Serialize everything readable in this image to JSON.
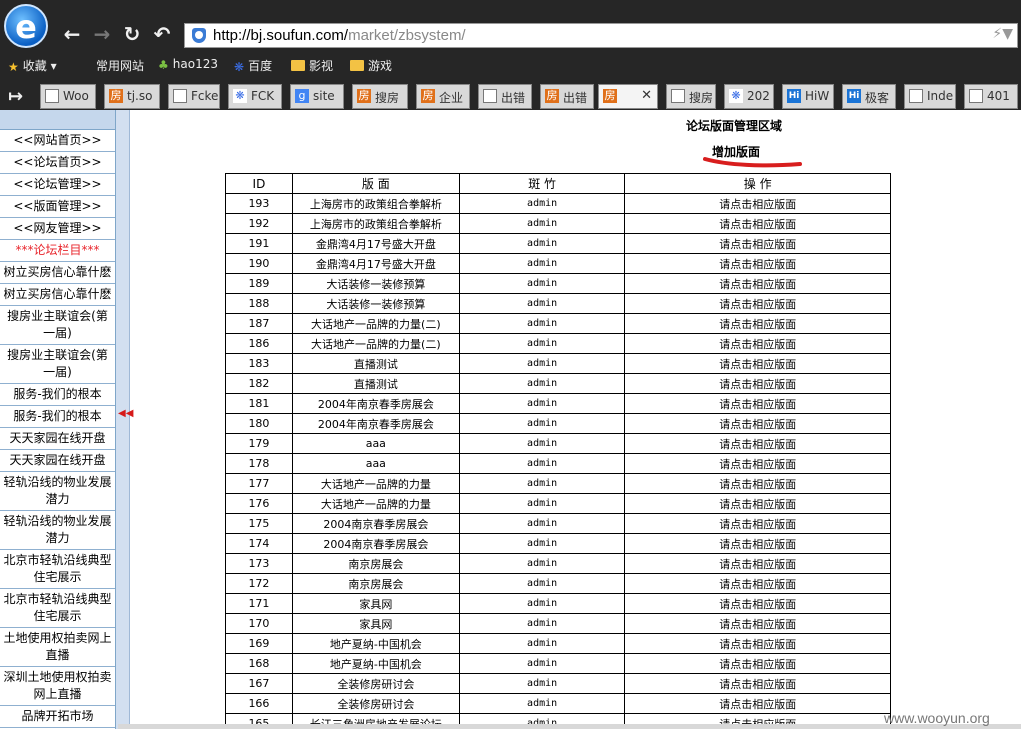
{
  "browser": {
    "url_host": "http://bj.soufun.com/",
    "url_path": "market/zbsystem/",
    "bookmarks": [
      {
        "label": "收藏",
        "icon": "star-icon"
      },
      {
        "label": "常用网站",
        "icon": "page-icon"
      },
      {
        "label": "hao123",
        "icon": "hao123-icon"
      },
      {
        "label": "百度",
        "icon": "baidu-paw-icon"
      },
      {
        "label": "影视",
        "icon": "folder-icon"
      },
      {
        "label": "游戏",
        "icon": "folder-icon"
      }
    ],
    "tabs": [
      {
        "label": "Woo",
        "icon": "page"
      },
      {
        "label": "tj.so",
        "icon": "fang"
      },
      {
        "label": "Fcke",
        "icon": "page"
      },
      {
        "label": "FCK",
        "icon": "paw2"
      },
      {
        "label": "site",
        "icon": "g"
      },
      {
        "label": "搜房",
        "icon": "fang"
      },
      {
        "label": "企业",
        "icon": "fang"
      },
      {
        "label": "出错",
        "icon": "page"
      },
      {
        "label": "出错",
        "icon": "fang"
      },
      {
        "label": "",
        "icon": "fang",
        "active": true
      },
      {
        "label": "搜房",
        "icon": "page"
      },
      {
        "label": "202",
        "icon": "paw2"
      },
      {
        "label": "HiW",
        "icon": "hi"
      },
      {
        "label": "极客",
        "icon": "hi"
      },
      {
        "label": "Inde",
        "icon": "page"
      },
      {
        "label": "401",
        "icon": "page"
      }
    ]
  },
  "sidebar": {
    "items": [
      {
        "label": "<<网站首页>>"
      },
      {
        "label": "<<论坛首页>>"
      },
      {
        "label": "<<论坛管理>>"
      },
      {
        "label": "<<版面管理>>"
      },
      {
        "label": "<<网友管理>>"
      },
      {
        "label": "***论坛栏目***",
        "section": true
      },
      {
        "label": "树立买房信心靠什麽"
      },
      {
        "label": "树立买房信心靠什麽"
      },
      {
        "label": "搜房业主联谊会(第一届)"
      },
      {
        "label": "搜房业主联谊会(第一届)"
      },
      {
        "label": "服务-我们的根本"
      },
      {
        "label": "服务-我们的根本"
      },
      {
        "label": "天天家园在线开盘"
      },
      {
        "label": "天天家园在线开盘"
      },
      {
        "label": "轻轨沿线的物业发展潜力"
      },
      {
        "label": "轻轨沿线的物业发展潜力"
      },
      {
        "label": "北京市轻轨沿线典型住宅展示"
      },
      {
        "label": "北京市轻轨沿线典型住宅展示"
      },
      {
        "label": "土地使用权拍卖网上直播"
      },
      {
        "label": "深圳土地使用权拍卖网上直播"
      },
      {
        "label": "品牌开拓市场"
      }
    ]
  },
  "main": {
    "title": "论坛版面管理区域",
    "add_link": "增加版面",
    "columns": [
      "ID",
      "版 面",
      "斑 竹",
      "操 作"
    ],
    "rows": [
      {
        "id": "193",
        "name": "上海房市的政策组合拳解析",
        "moderator": "admin",
        "action": "请点击相应版面"
      },
      {
        "id": "192",
        "name": "上海房市的政策组合拳解析",
        "moderator": "admin",
        "action": "请点击相应版面"
      },
      {
        "id": "191",
        "name": "金鼎湾4月17号盛大开盘",
        "moderator": "admin",
        "action": "请点击相应版面"
      },
      {
        "id": "190",
        "name": "金鼎湾4月17号盛大开盘",
        "moderator": "admin",
        "action": "请点击相应版面"
      },
      {
        "id": "189",
        "name": "大话装修一装修预算",
        "moderator": "admin",
        "action": "请点击相应版面"
      },
      {
        "id": "188",
        "name": "大话装修一装修预算",
        "moderator": "admin",
        "action": "请点击相应版面"
      },
      {
        "id": "187",
        "name": "大话地产一品牌的力量(二)",
        "moderator": "admin",
        "action": "请点击相应版面"
      },
      {
        "id": "186",
        "name": "大话地产一品牌的力量(二)",
        "moderator": "admin",
        "action": "请点击相应版面"
      },
      {
        "id": "183",
        "name": "直播测试",
        "moderator": "admin",
        "action": "请点击相应版面"
      },
      {
        "id": "182",
        "name": "直播测试",
        "moderator": "admin",
        "action": "请点击相应版面"
      },
      {
        "id": "181",
        "name": "2004年南京春季房展会",
        "moderator": "admin",
        "action": "请点击相应版面"
      },
      {
        "id": "180",
        "name": "2004年南京春季房展会",
        "moderator": "admin",
        "action": "请点击相应版面"
      },
      {
        "id": "179",
        "name": "aaa",
        "moderator": "admin",
        "action": "请点击相应版面"
      },
      {
        "id": "178",
        "name": "aaa",
        "moderator": "admin",
        "action": "请点击相应版面"
      },
      {
        "id": "177",
        "name": "大话地产一品牌的力量",
        "moderator": "admin",
        "action": "请点击相应版面"
      },
      {
        "id": "176",
        "name": "大话地产一品牌的力量",
        "moderator": "admin",
        "action": "请点击相应版面"
      },
      {
        "id": "175",
        "name": "2004南京春季房展会",
        "moderator": "admin",
        "action": "请点击相应版面"
      },
      {
        "id": "174",
        "name": "2004南京春季房展会",
        "moderator": "admin",
        "action": "请点击相应版面"
      },
      {
        "id": "173",
        "name": "南京房展会",
        "moderator": "admin",
        "action": "请点击相应版面"
      },
      {
        "id": "172",
        "name": "南京房展会",
        "moderator": "admin",
        "action": "请点击相应版面"
      },
      {
        "id": "171",
        "name": "家具网",
        "moderator": "admin",
        "action": "请点击相应版面"
      },
      {
        "id": "170",
        "name": "家具网",
        "moderator": "admin",
        "action": "请点击相应版面"
      },
      {
        "id": "169",
        "name": "地产夏纳-中国机会",
        "moderator": "admin",
        "action": "请点击相应版面"
      },
      {
        "id": "168",
        "name": "地产夏纳-中国机会",
        "moderator": "admin",
        "action": "请点击相应版面"
      },
      {
        "id": "167",
        "name": "全装修房研讨会",
        "moderator": "admin",
        "action": "请点击相应版面"
      },
      {
        "id": "166",
        "name": "全装修房研讨会",
        "moderator": "admin",
        "action": "请点击相应版面"
      },
      {
        "id": "165",
        "name": "长江三角洲房地产发展论坛",
        "moderator": "admin",
        "action": "请点击相应版面"
      }
    ]
  },
  "watermark": "www.wooyun.org",
  "colors": {
    "chrome": "#262626",
    "sidebar_border": "#7fa6c9",
    "section_red": "#e8242b",
    "annotation_red": "#d81e1e"
  }
}
